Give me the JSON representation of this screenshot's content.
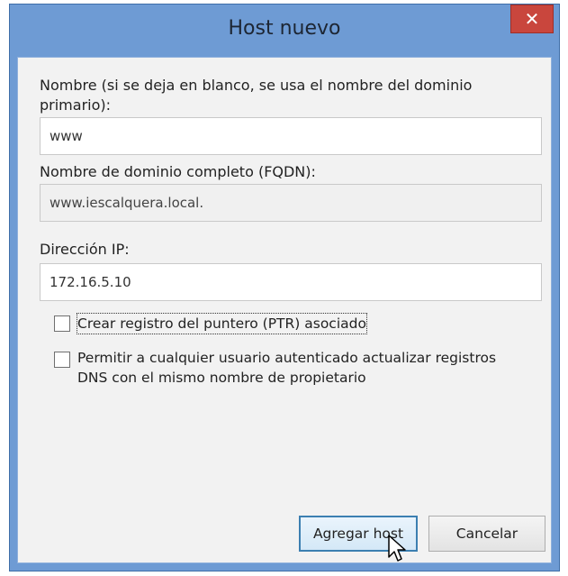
{
  "dialog": {
    "title": "Host nuevo",
    "close_glyph": "✕"
  },
  "name_field": {
    "label_line1": "Nombre (si se deja en blanco, se usa el nombre del dominio",
    "label_line2": "primario):",
    "value": "www"
  },
  "fqdn_field": {
    "label": "Nombre de dominio completo (FQDN):",
    "value": "www.iescalquera.local."
  },
  "ip_field": {
    "label": "Dirección IP:",
    "value": "172.16.5.10"
  },
  "checkboxes": [
    {
      "label": "Crear registro del puntero (PTR) asociado",
      "checked": false
    },
    {
      "label_line1": "Permitir a cualquier usuario autenticado actualizar registros",
      "label_line2": "DNS con el mismo nombre de propietario",
      "checked": false
    }
  ],
  "buttons": {
    "add_host": "Agregar host",
    "cancel": "Cancelar"
  },
  "colors": {
    "frame": "#6e9bd4",
    "close": "#c9463d",
    "client_bg": "#f2f2f2",
    "default_button_border": "#3c7fb1"
  },
  "icons": {
    "close": "close-icon",
    "cursor": "mouse-pointer-icon"
  }
}
